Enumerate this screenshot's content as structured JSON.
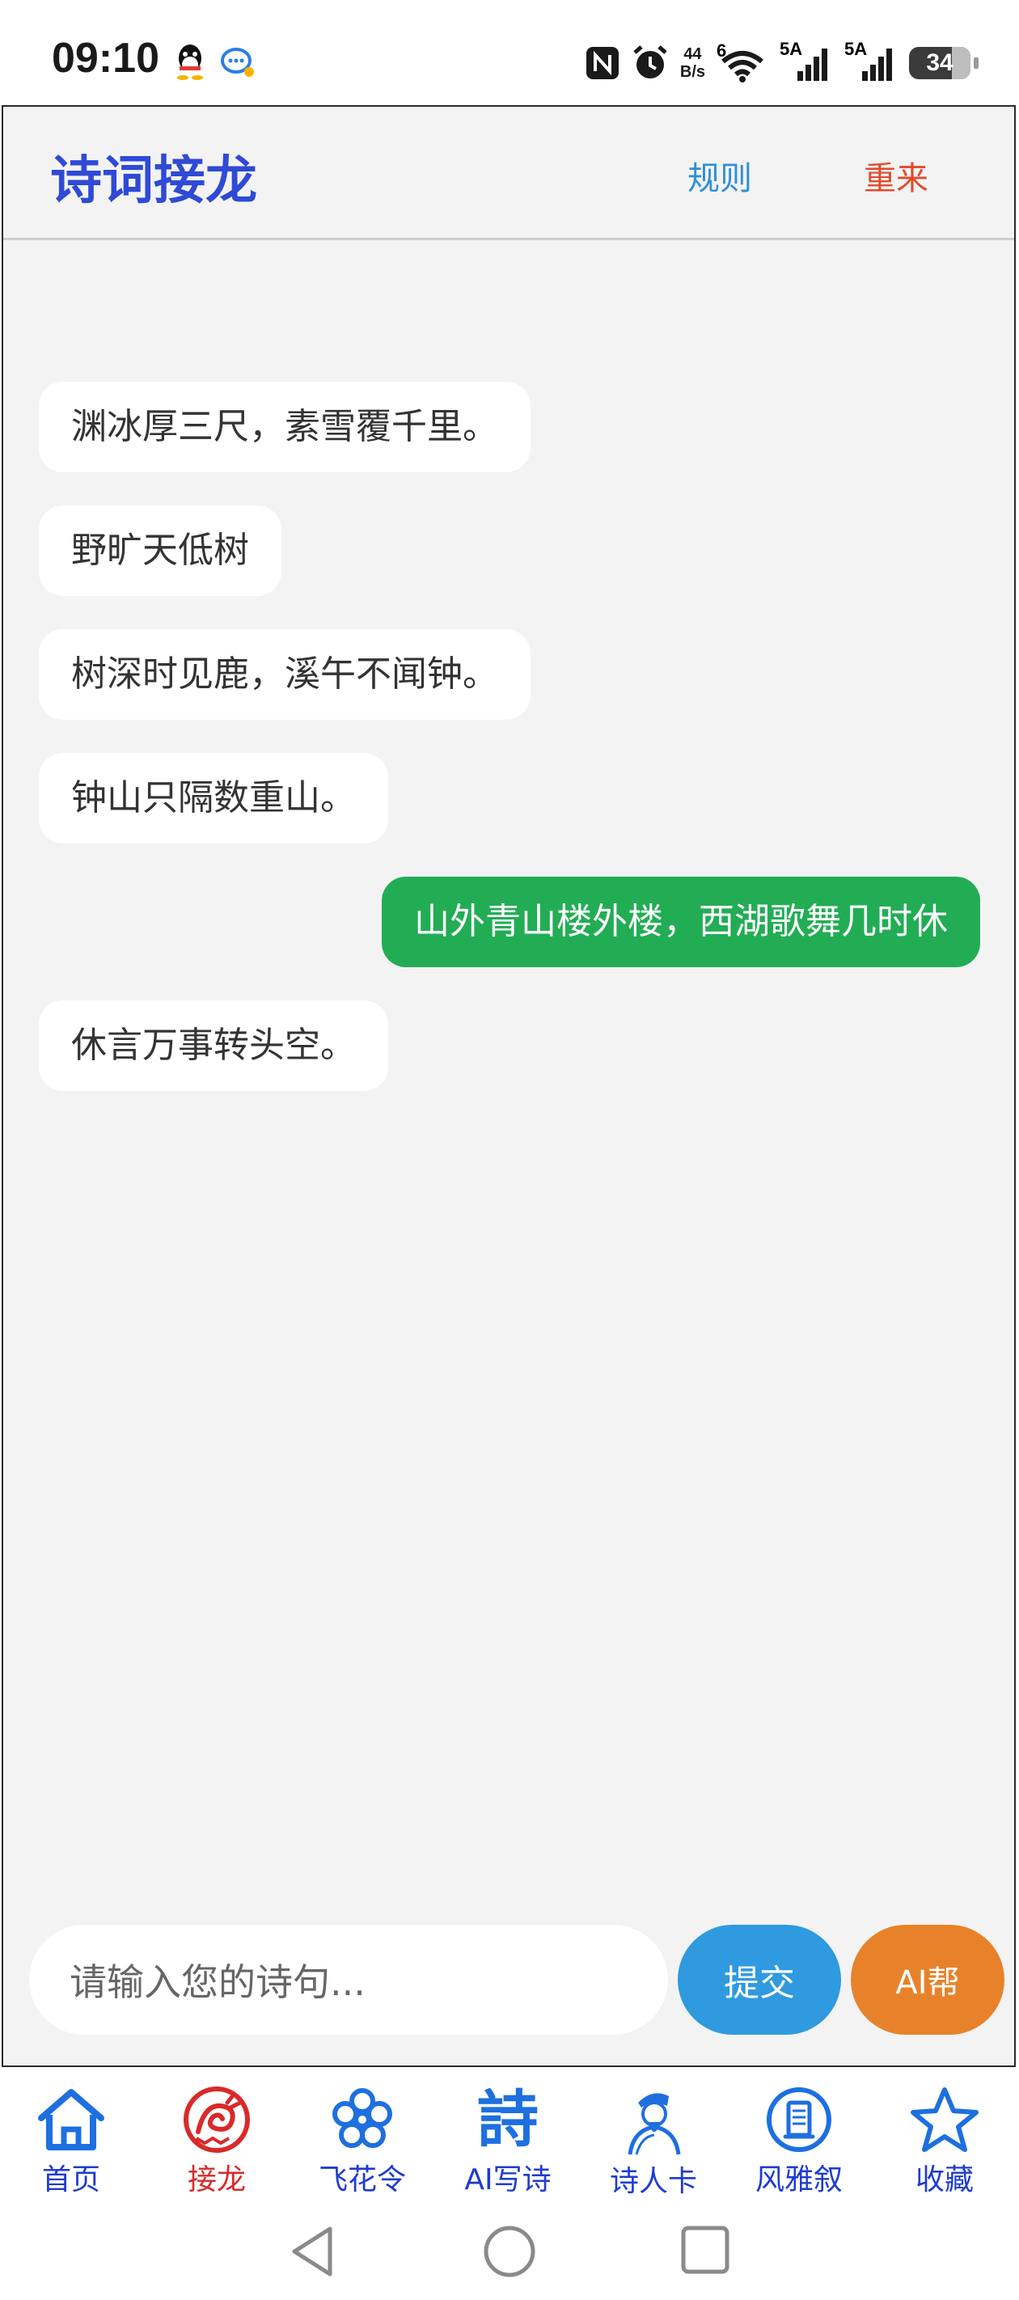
{
  "status_bar": {
    "time": "09:10",
    "net_speed_value": "44",
    "net_speed_unit": "B/s",
    "wifi_label": "6",
    "signal1_label": "5A",
    "signal2_label": "5A",
    "battery": "34",
    "icons": [
      "qq-icon",
      "message-icon",
      "nfc-icon",
      "alarm-icon",
      "wifi-icon",
      "signal-icon",
      "battery-icon"
    ]
  },
  "header": {
    "title": "诗词接龙",
    "rules_label": "规则",
    "restart_label": "重来"
  },
  "messages": [
    {
      "side": "left",
      "text": "渊冰厚三尺，素雪覆千里。"
    },
    {
      "side": "left",
      "text": "野旷天低树"
    },
    {
      "side": "left",
      "text": "树深时见鹿，溪午不闻钟。"
    },
    {
      "side": "left",
      "text": "钟山只隔数重山。"
    },
    {
      "side": "right",
      "text": "山外青山楼外楼，西湖歌舞几时休"
    },
    {
      "side": "left",
      "text": "休言万事转头空。"
    }
  ],
  "input": {
    "placeholder": "请输入您的诗句...",
    "submit_label": "提交",
    "ai_label": "AI帮"
  },
  "bottom_nav": [
    {
      "label": "首页",
      "icon": "home-icon",
      "active": false
    },
    {
      "label": "接龙",
      "icon": "dragon-icon",
      "active": true
    },
    {
      "label": "飞花令",
      "icon": "flower-icon",
      "active": false
    },
    {
      "label": "AI写诗",
      "icon": "poem-char-icon",
      "glyph": "詩",
      "active": false
    },
    {
      "label": "诗人卡",
      "icon": "poet-portrait-icon",
      "active": false
    },
    {
      "label": "风雅叙",
      "icon": "scroll-icon",
      "active": false
    },
    {
      "label": "收藏",
      "icon": "star-icon",
      "active": false
    }
  ],
  "colors": {
    "title": "#2f4ad6",
    "rules": "#2f8fd8",
    "restart": "#e24b2c",
    "user_bubble": "#22ad55",
    "submit": "#2f9adf",
    "ai": "#e8822a",
    "nav": "#1f3bd1",
    "nav_active": "#d92a2a"
  }
}
